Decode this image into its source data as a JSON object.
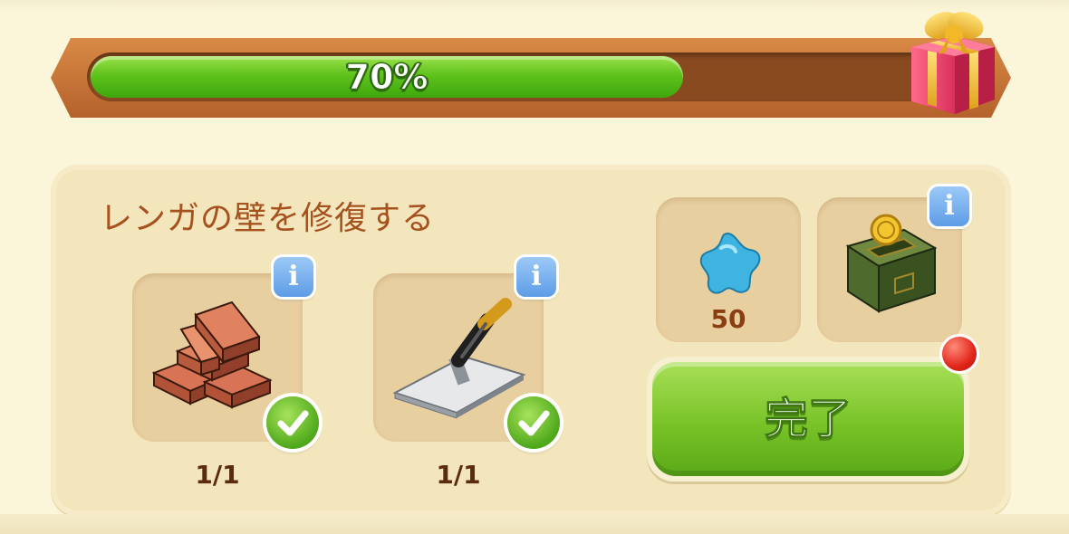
{
  "progress": {
    "percent": 70,
    "label": "70%",
    "fill_color": "#5fc21c",
    "reward_icon": "gift-box-icon"
  },
  "task": {
    "title": "レンガの壁を修復する",
    "requirements": [
      {
        "icon": "bricks-icon",
        "count": "1/1",
        "completed": true
      },
      {
        "icon": "trowel-icon",
        "count": "1/1",
        "completed": true
      }
    ]
  },
  "rewards": {
    "gem": {
      "icon": "blue-star-gem-icon",
      "value": "50"
    },
    "chest": {
      "icon": "coin-chest-icon"
    }
  },
  "complete_button": {
    "label": "完了",
    "color": "#79c328",
    "has_notification": true,
    "notification_color": "#e2261b"
  },
  "info_icon": "info-icon"
}
